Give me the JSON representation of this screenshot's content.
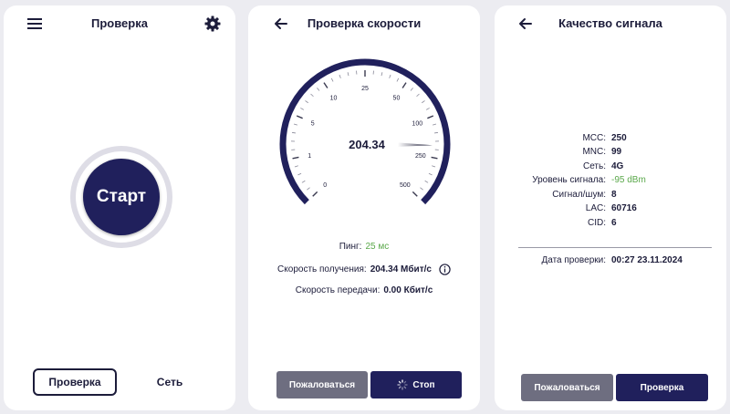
{
  "panel_check": {
    "title": "Проверка",
    "start_label": "Старт",
    "tabs": [
      {
        "label": "Проверка",
        "active": true
      },
      {
        "label": "Сеть",
        "active": false
      }
    ]
  },
  "panel_speed": {
    "title": "Проверка скорости",
    "gauge": {
      "value_text": "204.34",
      "value": 204.34,
      "ticks": [
        "0",
        "1",
        "5",
        "10",
        "25",
        "50",
        "100",
        "250",
        "500"
      ]
    },
    "ping": {
      "label": "Пинг:",
      "value": "25 мс"
    },
    "download": {
      "label": "Скорость получения:",
      "value": "204.34 Мбит/с"
    },
    "upload": {
      "label": "Скорость передачи:",
      "value": "0.00 Кбит/с"
    },
    "complain_label": "Пожаловаться",
    "stop_label": "Стоп"
  },
  "panel_signal": {
    "title": "Качество сигнала",
    "rows": [
      {
        "key": "MCC:",
        "value": "250"
      },
      {
        "key": "MNC:",
        "value": "99"
      },
      {
        "key": "Сеть:",
        "value": "4G"
      },
      {
        "key": "Уровень сигнала:",
        "value": "-95 dBm"
      },
      {
        "key": "Сигнал/шум:",
        "value": "8"
      },
      {
        "key": "LAC:",
        "value": "60716"
      },
      {
        "key": "CID:",
        "value": "6"
      }
    ],
    "check_date": {
      "label": "Дата проверки:",
      "value": "00:27 23.11.2024"
    },
    "complain_label": "Пожаловаться",
    "check_label": "Проверка"
  },
  "colors": {
    "navy": "#20205c",
    "gray_button": "#6e6e80",
    "green_value": "#5aa84a",
    "background": "#ececf1"
  },
  "icons": [
    "menu-icon",
    "gear-icon",
    "back-arrow-icon",
    "info-icon",
    "spinner-icon"
  ]
}
